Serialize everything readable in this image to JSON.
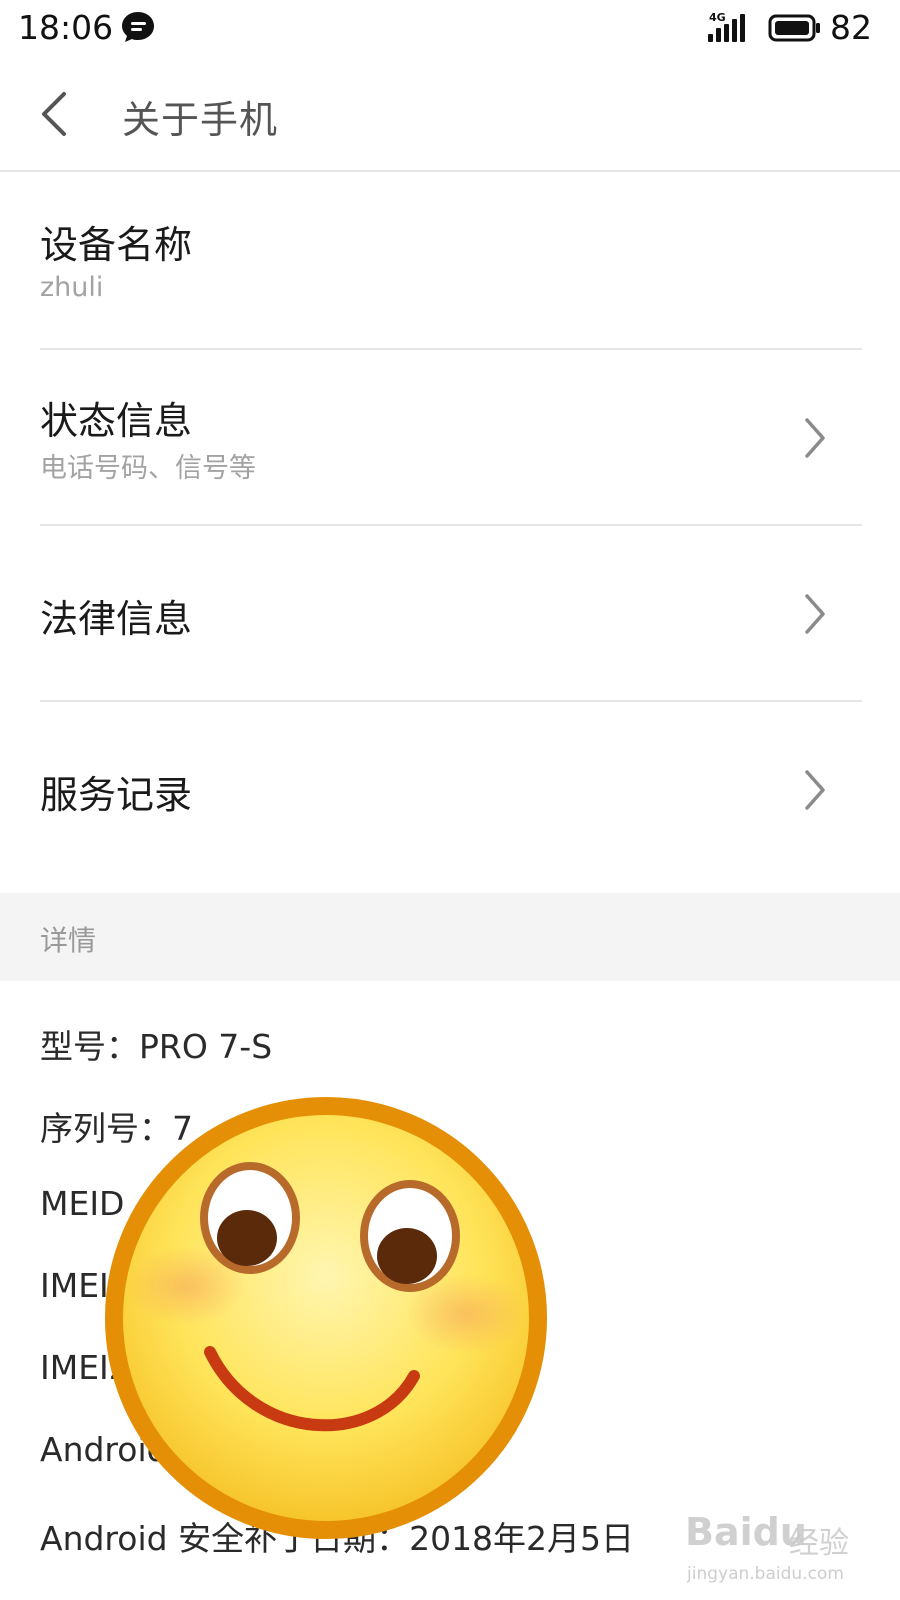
{
  "status_bar": {
    "time": "18:06",
    "network": "4G",
    "battery": "82",
    "icons": [
      "message-icon",
      "signal-icon",
      "battery-icon"
    ]
  },
  "header": {
    "back_icon": "back-arrow-icon",
    "title": "关于手机"
  },
  "list": [
    {
      "title": "设备名称",
      "subtitle": "zhuli",
      "has_chevron": false
    },
    {
      "title": "状态信息",
      "subtitle": "电话号码、信号等",
      "has_chevron": true
    },
    {
      "title": "法律信息",
      "subtitle": "",
      "has_chevron": true
    },
    {
      "title": "服务记录",
      "subtitle": "",
      "has_chevron": true
    }
  ],
  "section": {
    "label": "详情"
  },
  "details": {
    "model": "型号：PRO 7-S",
    "serial": "序列号：7",
    "meid": "MEID",
    "imei1": "IMEI",
    "imei2": "IMEI2",
    "android_version": "Android",
    "security_patch": "Android 安全补丁日期：2018年2月5日"
  },
  "overlay": {
    "icon": "smiley-face-icon"
  },
  "watermark": {
    "brand": "Baidu",
    "text": "经验",
    "url": "jingyan.baidu.com"
  },
  "colors": {
    "divider": "#e6e6e6",
    "section_bg": "#f4f4f4",
    "subtitle": "#a3a3a3"
  }
}
